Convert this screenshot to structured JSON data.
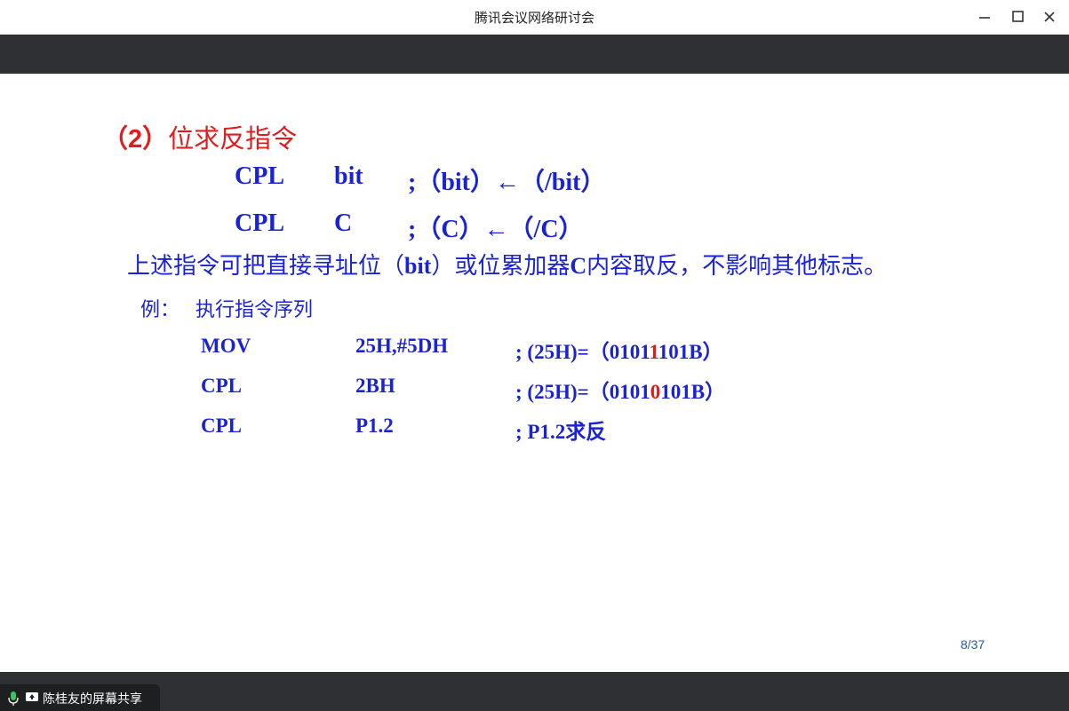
{
  "window": {
    "title": "腾讯会议网络研讨会",
    "controls": {
      "minimize": "minimize-icon",
      "maximize": "maximize-icon",
      "close": "close-icon"
    }
  },
  "slide": {
    "heading_num": "（2）",
    "heading_text": "位求反指令",
    "instructions": [
      {
        "op": "CPL",
        "arg": "bit",
        "comment": ";（bit）←（/bit）"
      },
      {
        "op": "CPL",
        "arg": "C",
        "comment": ";（C）←（/C）"
      }
    ],
    "description": {
      "before": "上述指令可把直接寻址位（",
      "bold": "bit",
      "after": "）或位累加器",
      "bold2": "C",
      "end": "内容取反，不影响其他标志。"
    },
    "example": {
      "label": "例：",
      "text": "执行指令序列"
    },
    "code": [
      {
        "op": "MOV",
        "arg": "25H,#5DH",
        "comment_pre": "; (25H)=（0101",
        "comment_hl": "1",
        "comment_post": "101B）"
      },
      {
        "op": "CPL",
        "arg": "2BH",
        "comment_pre": "; (25H)=（0101",
        "comment_hl": "0",
        "comment_post": "101B）"
      },
      {
        "op": "CPL",
        "arg": "P1.2",
        "comment_pre": "; P1.2求反",
        "comment_hl": "",
        "comment_post": ""
      }
    ],
    "page": "8/37"
  },
  "share": {
    "label": "陈桂友的屏幕共享",
    "mic_icon": "microphone-icon",
    "screen_icon": "screen-share-icon"
  },
  "colors": {
    "blue": "#1a23d4",
    "red": "#e31b1b",
    "bar": "#2e3033"
  }
}
